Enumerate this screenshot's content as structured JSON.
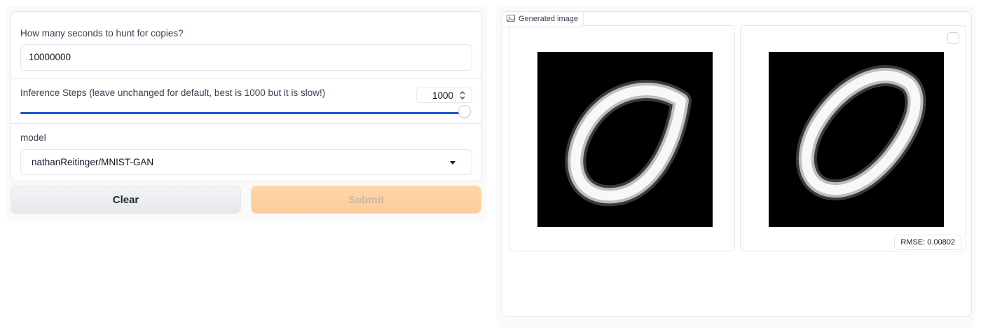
{
  "form": {
    "seconds_label": "How many seconds to hunt for copies?",
    "seconds_value": "10000000",
    "steps_label": "Inference Steps (leave unchanged for default, best is 1000 but it is slow!)",
    "steps_value": "1000",
    "steps_slider_fraction": 1.0,
    "model_label": "model",
    "model_value": "nathanReitinger/MNIST-GAN"
  },
  "buttons": {
    "clear_label": "Clear",
    "submit_label": "Submit"
  },
  "gallery": {
    "label": "Generated image",
    "caption": "RMSE: 0.00802"
  },
  "colors": {
    "accent_slider": "#2154d0",
    "submit_bg": "#fdcb9a"
  }
}
